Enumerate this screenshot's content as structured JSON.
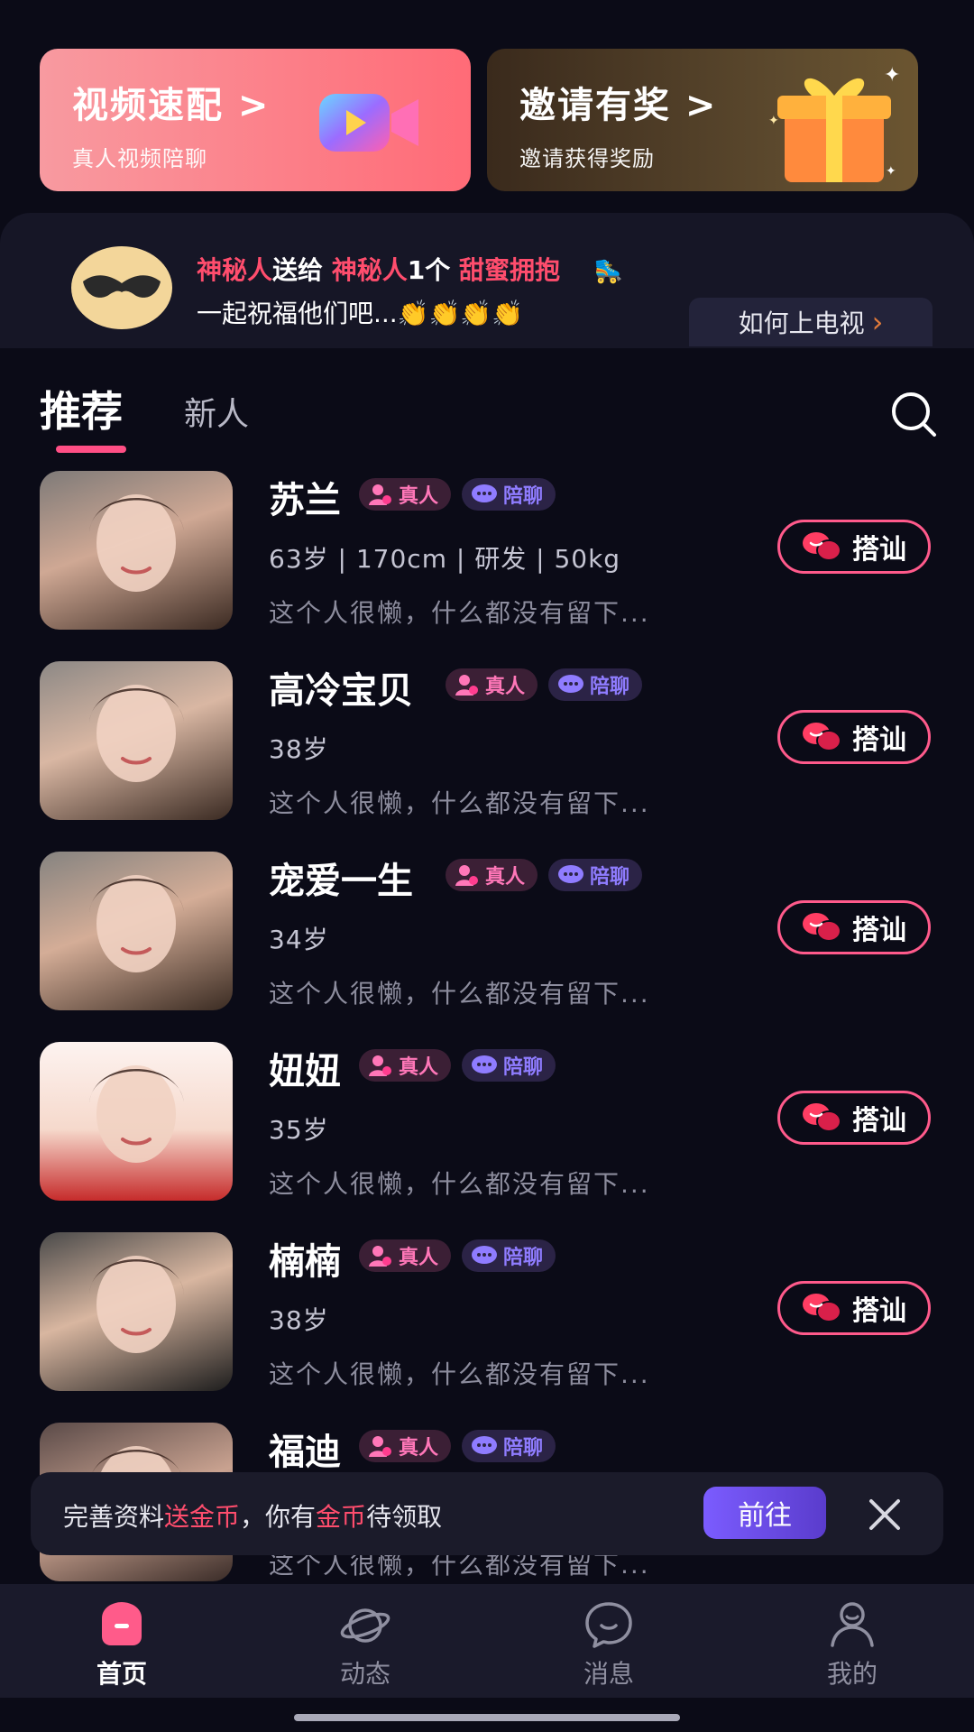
{
  "banners": {
    "video_match": {
      "title": "视频速配 >",
      "subtitle": "真人视频陪聊"
    },
    "invite": {
      "title": "邀请有奖 >",
      "subtitle": "邀请获得奖励"
    }
  },
  "broadcast": {
    "sender": "神秘人",
    "action": "送给",
    "receiver": "神秘人",
    "count": "1个",
    "gift": "甜蜜拥抱",
    "line2": "一起祝福他们吧...👏👏👏👏",
    "tv_button": "如何上电视"
  },
  "tabs": {
    "recommend": "推荐",
    "new": "新人"
  },
  "badge_labels": {
    "real": "真人",
    "chat": "陪聊"
  },
  "chat_button_label": "搭讪",
  "users": [
    {
      "name": "苏兰",
      "info": "63岁 | 170cm | 研发 | 50kg",
      "bio": "这个人很懒，什么都没有留下..."
    },
    {
      "name": "高冷宝贝",
      "info": "38岁",
      "bio": "这个人很懒，什么都没有留下..."
    },
    {
      "name": "宠爱一生",
      "info": "34岁",
      "bio": "这个人很懒，什么都没有留下..."
    },
    {
      "name": "妞妞",
      "info": "35岁",
      "bio": "这个人很懒，什么都没有留下..."
    },
    {
      "name": "楠楠",
      "info": "38岁",
      "bio": "这个人很懒，什么都没有留下..."
    },
    {
      "name": "福迪",
      "info": "",
      "bio": "这个人很懒，什么都没有留下..."
    }
  ],
  "toast": {
    "text_a": "完善资料",
    "text_b": "送金币",
    "text_c": "，你有",
    "text_d": "金币",
    "text_e": "待领取",
    "go": "前往"
  },
  "nav": [
    {
      "label": "首页",
      "icon": "home-icon",
      "active": true
    },
    {
      "label": "动态",
      "icon": "planet-icon",
      "active": false
    },
    {
      "label": "消息",
      "icon": "message-icon",
      "active": false
    },
    {
      "label": "我的",
      "icon": "profile-icon",
      "active": false
    }
  ],
  "colors": {
    "accent": "#ff4f85",
    "background": "#0b0b17",
    "highlight": "#ff4d6d"
  }
}
